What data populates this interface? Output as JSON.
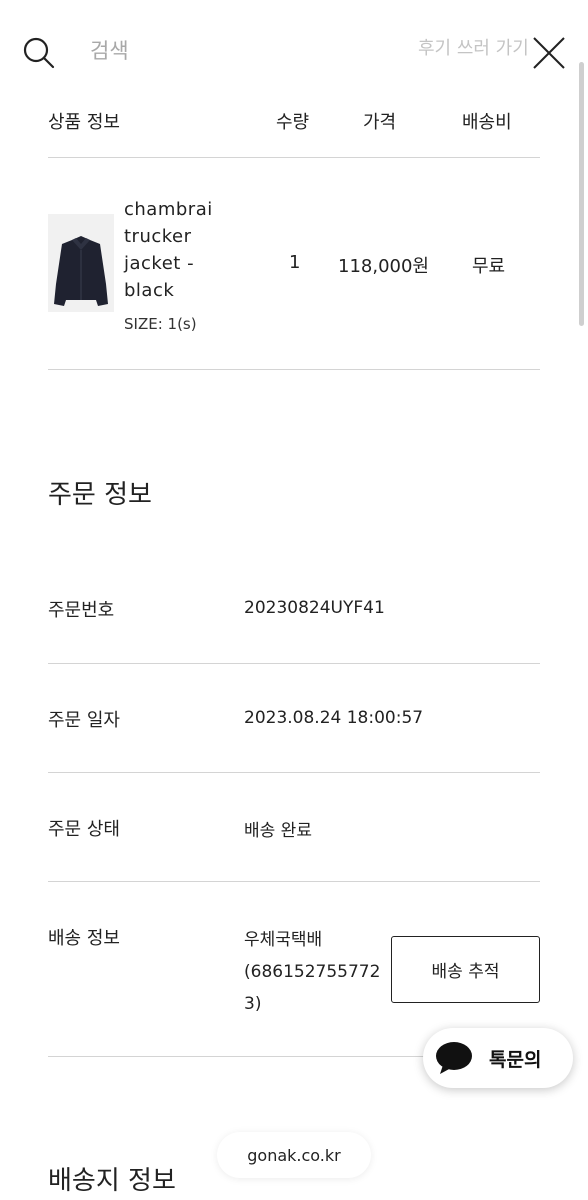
{
  "search": {
    "placeholder": "검색",
    "faded_text": "후기 쓰러 가기"
  },
  "table": {
    "headers": {
      "product": "상품 정보",
      "qty": "수량",
      "price": "가격",
      "shipping": "배송비"
    },
    "item": {
      "name_lines": [
        "chambrai",
        "trucker",
        "jacket -",
        "black"
      ],
      "size": "SIZE: 1(s)",
      "qty": "1",
      "price": "118,000원",
      "shipping": "무료"
    }
  },
  "order_info": {
    "title": "주문 정보",
    "rows": [
      {
        "label": "주문번호",
        "value": "20230824UYF41"
      },
      {
        "label": "주문 일자",
        "value": "2023.08.24 18:00:57"
      },
      {
        "label": "주문 상태",
        "value": "배송 완료"
      }
    ],
    "shipping": {
      "label": "배송 정보",
      "lines": [
        "우체국택배",
        "(686152755772",
        "3)"
      ],
      "track_button": "배송 추적"
    }
  },
  "chat": {
    "label": "톡문의"
  },
  "domain": "gonak.co.kr",
  "delivery_info": {
    "title": "배송지 정보"
  }
}
